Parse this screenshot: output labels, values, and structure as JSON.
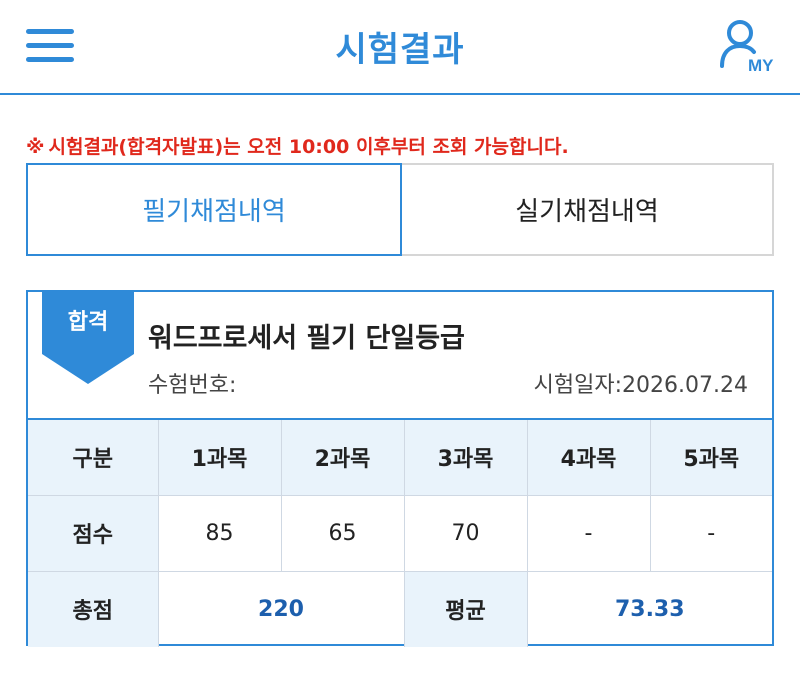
{
  "header": {
    "title": "시험결과",
    "my_label": "MY"
  },
  "notice": {
    "mark": "※",
    "text_before": "시험결과(합격자발표)는 오전 ",
    "time": "10:00",
    "text_after": " 이후부터 조회 가능합니다."
  },
  "tabs": [
    {
      "label": "필기채점내역",
      "active": true
    },
    {
      "label": "실기채점내역",
      "active": false
    }
  ],
  "result": {
    "badge": "합격",
    "exam_name": "워드프로세서 필기 단일등급",
    "exam_number_label": "수험번호:",
    "exam_date": "시험일자:2026.07.24"
  },
  "score_table": {
    "header": [
      "구분",
      "1과목",
      "2과목",
      "3과목",
      "4과목",
      "5과목"
    ],
    "scores_label": "점수",
    "scores": [
      "85",
      "65",
      "70",
      "-",
      "-"
    ],
    "total_label": "총점",
    "total": "220",
    "average_label": "평균",
    "average": "73.33"
  },
  "colors": {
    "accent": "#2f8ad8",
    "notice": "#e0281c",
    "header_cell": "#e9f3fb",
    "value_blue": "#1d5fad"
  },
  "icons": {
    "menu": "hamburger-menu-icon",
    "my": "user-icon"
  }
}
